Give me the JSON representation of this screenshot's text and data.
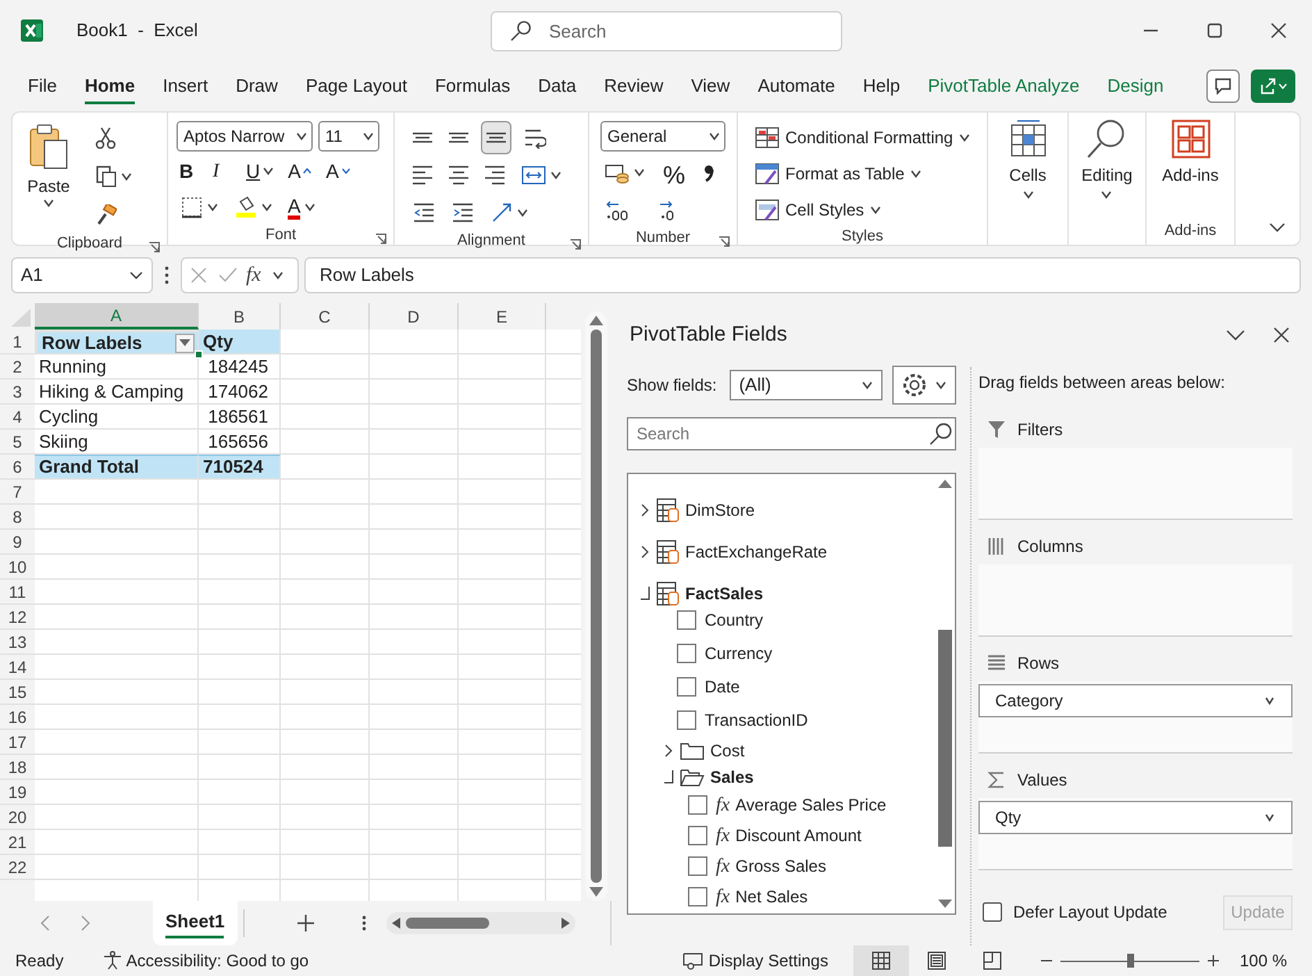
{
  "window": {
    "title": "Book1  -  Excel"
  },
  "search": {
    "placeholder": "Search"
  },
  "menu_tabs": [
    {
      "label": "File",
      "selected": false,
      "kind": "standard"
    },
    {
      "label": "Home",
      "selected": true,
      "kind": "standard"
    },
    {
      "label": "Insert",
      "selected": false,
      "kind": "standard"
    },
    {
      "label": "Draw",
      "selected": false,
      "kind": "standard"
    },
    {
      "label": "Page Layout",
      "selected": false,
      "kind": "standard"
    },
    {
      "label": "Formulas",
      "selected": false,
      "kind": "standard"
    },
    {
      "label": "Data",
      "selected": false,
      "kind": "standard"
    },
    {
      "label": "Review",
      "selected": false,
      "kind": "standard"
    },
    {
      "label": "View",
      "selected": false,
      "kind": "standard"
    },
    {
      "label": "Automate",
      "selected": false,
      "kind": "standard"
    },
    {
      "label": "Help",
      "selected": false,
      "kind": "standard"
    },
    {
      "label": "PivotTable Analyze",
      "selected": false,
      "kind": "contextual"
    },
    {
      "label": "Design",
      "selected": false,
      "kind": "contextual"
    }
  ],
  "ribbon": {
    "clipboard": {
      "paste": "Paste",
      "label": "Clipboard"
    },
    "font": {
      "font_name": "Aptos Narrow",
      "font_size": "11",
      "bold": "B",
      "italic": "I",
      "underline": "U",
      "grow": "A",
      "shrink": "A",
      "font_color": "A",
      "label": "Font"
    },
    "alignment": {
      "label": "Alignment"
    },
    "number": {
      "format": "General",
      "percent": "%",
      "label": "Number"
    },
    "styles": {
      "buttons": [
        "Conditional Formatting",
        "Format as Table",
        "Cell Styles"
      ],
      "label": "Styles"
    },
    "cells": {
      "button": "Cells"
    },
    "editing": {
      "button": "Editing"
    },
    "addins": {
      "button": "Add-ins",
      "label": "Add-ins"
    }
  },
  "formula_bar": {
    "name_box": "A1",
    "function_symbol": "fx",
    "content": "Row Labels"
  },
  "sheet": {
    "columns": [
      {
        "label": "A",
        "selected": true
      },
      {
        "label": "B",
        "selected": false
      },
      {
        "label": "C",
        "selected": false
      },
      {
        "label": "D",
        "selected": false
      },
      {
        "label": "E",
        "selected": false
      }
    ],
    "row_numbers": [
      "1",
      "2",
      "3",
      "4",
      "5",
      "6",
      "7",
      "8",
      "9",
      "10",
      "11",
      "12",
      "13",
      "14",
      "15",
      "16",
      "17",
      "18",
      "19",
      "20",
      "21",
      "22"
    ],
    "pivot_rows": [
      {
        "kind": "header",
        "label": "Row Labels",
        "value": "Qty"
      },
      {
        "kind": "item",
        "label": "Running",
        "value": "184245"
      },
      {
        "kind": "item",
        "label": "Hiking & Camping",
        "value": "174062"
      },
      {
        "kind": "item",
        "label": "Cycling",
        "value": "186561"
      },
      {
        "kind": "item",
        "label": "Skiing",
        "value": "165656"
      },
      {
        "kind": "total",
        "label": "Grand Total",
        "value": "710524"
      }
    ]
  },
  "sheet_tabs": [
    {
      "label": "Sheet1",
      "selected": true
    }
  ],
  "pivot_pane": {
    "title": "PivotTable Fields",
    "show_fields_label": "Show fields:",
    "show_fields_value": "(All)",
    "search_placeholder": "Search",
    "hint": "Drag fields between areas below:",
    "fields": [
      {
        "kind": "table",
        "label": "DimStore",
        "expanded": false
      },
      {
        "kind": "table",
        "label": "FactExchangeRate",
        "expanded": false
      },
      {
        "kind": "table",
        "label": "FactSales",
        "expanded": true,
        "children": [
          {
            "kind": "field",
            "label": "Country",
            "checked": false
          },
          {
            "kind": "field",
            "label": "Currency",
            "checked": false
          },
          {
            "kind": "field",
            "label": "Date",
            "checked": false
          },
          {
            "kind": "field",
            "label": "TransactionID",
            "checked": false
          },
          {
            "kind": "folder",
            "label": "Cost",
            "expanded": false
          },
          {
            "kind": "folder",
            "label": "Sales",
            "expanded": true,
            "children": [
              {
                "kind": "measure",
                "symbol": "fx",
                "label": "Average Sales Price",
                "checked": false
              },
              {
                "kind": "measure",
                "symbol": "fx",
                "label": "Discount Amount",
                "checked": false
              },
              {
                "kind": "measure",
                "symbol": "fx",
                "label": "Gross Sales",
                "checked": false
              },
              {
                "kind": "measure",
                "symbol": "fx",
                "label": "Net Sales",
                "checked": false
              }
            ]
          }
        ]
      }
    ],
    "areas": [
      {
        "kind": "filters",
        "label": "Filters"
      },
      {
        "kind": "columns",
        "label": "Columns"
      },
      {
        "kind": "rows",
        "label": "Rows",
        "items": [
          "Category"
        ]
      },
      {
        "kind": "values",
        "label": "Values",
        "items": [
          "Qty"
        ]
      }
    ],
    "defer": {
      "label": "Defer Layout Update",
      "checked": false
    },
    "update": {
      "label": "Update",
      "disabled": true
    }
  },
  "status_bar": {
    "mode": "Ready",
    "accessibility": "Accessibility: Good to go",
    "display_settings": "Display Settings",
    "views": [
      {
        "kind": "normal",
        "selected": true
      },
      {
        "kind": "page_layout",
        "selected": false
      },
      {
        "kind": "page_break",
        "selected": false
      }
    ],
    "zoom": {
      "level": 0.5,
      "reading": "100 %"
    }
  }
}
